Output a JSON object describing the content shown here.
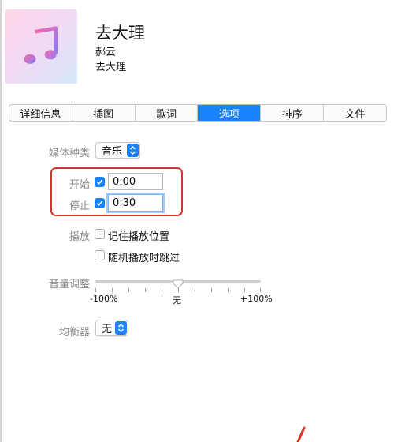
{
  "header": {
    "title": "去大理",
    "artist": "郝云",
    "album": "去大理",
    "artwork_icon": "music-note-icon"
  },
  "tabs": [
    {
      "label": "详细信息",
      "active": false
    },
    {
      "label": "插图",
      "active": false
    },
    {
      "label": "歌词",
      "active": false
    },
    {
      "label": "选项",
      "active": true
    },
    {
      "label": "排序",
      "active": false
    },
    {
      "label": "文件",
      "active": false
    }
  ],
  "options": {
    "media_kind": {
      "label": "媒体种类",
      "value": "音乐"
    },
    "start": {
      "label": "开始",
      "checked": true,
      "value": "0:00"
    },
    "stop": {
      "label": "停止",
      "checked": true,
      "value": "0:30"
    },
    "playback": {
      "label": "播放",
      "remember_position": {
        "text": "记住播放位置",
        "checked": false
      },
      "skip_when_shuffling": {
        "text": "随机播放时跳过",
        "checked": false
      }
    },
    "volume": {
      "label": "音量调整",
      "min_label": "-100%",
      "mid_label": "无",
      "max_label": "+100%",
      "level_percent": 0
    },
    "equalizer": {
      "label": "均衡器",
      "value": "无"
    }
  },
  "colors": {
    "accent": "#1a82fb",
    "highlight_box": "#d7322b"
  }
}
